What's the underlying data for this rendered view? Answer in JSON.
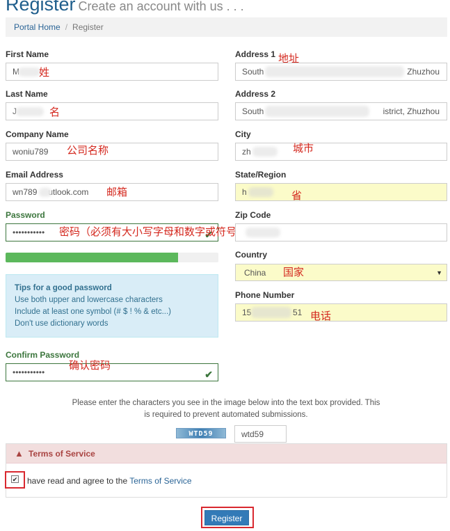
{
  "header": {
    "title": "Register",
    "subtitle": "Create an account with us . . ."
  },
  "breadcrumb": {
    "home": "Portal Home",
    "separator": "/",
    "current": "Register"
  },
  "form": {
    "first_name": {
      "label": "First Name",
      "value": "M",
      "annotation": "姓"
    },
    "last_name": {
      "label": "Last Name",
      "value": "J",
      "annotation": "名"
    },
    "company": {
      "label": "Company Name",
      "value": "woniu789",
      "annotation": "公司名称"
    },
    "email": {
      "label": "Email Address",
      "value_a": "wn789",
      "value_b": "utlook.com",
      "annotation": "邮箱"
    },
    "password": {
      "label": "Password",
      "value": "•••••••••••",
      "annotation": "密码（必须有大小写字母和数字或符号）",
      "strength": 0.81
    },
    "tips": {
      "title": "Tips for a good password",
      "line1": "Use both upper and lowercase characters",
      "line2": "Include at least one symbol (# $ ! % & etc...)",
      "line3": "Don't use dictionary words"
    },
    "confirm_password": {
      "label": "Confirm Password",
      "value": "•••••••••••",
      "annotation": "确认密码"
    },
    "address1": {
      "label": "Address 1",
      "value_a": "South",
      "value_b": "Zhuzhou",
      "annotation": "地址"
    },
    "address2": {
      "label": "Address 2",
      "value_a": "South",
      "value_b": "istrict, Zhuzhou"
    },
    "city": {
      "label": "City",
      "value": "zh",
      "annotation": "城市"
    },
    "state": {
      "label": "State/Region",
      "value": "h",
      "annotation": "省"
    },
    "zip": {
      "label": "Zip Code",
      "value": ""
    },
    "country": {
      "label": "Country",
      "value": "China",
      "annotation": "国家"
    },
    "phone": {
      "label": "Phone Number",
      "value_a": "15",
      "value_b": "51",
      "annotation": "电话"
    }
  },
  "captcha": {
    "instructions": "Please enter the characters you see in the image below into the text box provided. This is required to prevent automated submissions.",
    "image_text": "WTD59",
    "value": "wtd59"
  },
  "tos": {
    "header": "Terms of Service",
    "checkbox_checked": true,
    "agree_text": "have read and agree to the",
    "link": "Terms of Service"
  },
  "submit": {
    "label": "Register"
  },
  "colors": {
    "accent": "#337ab7",
    "success": "#5cb85c",
    "annotation": "#d4281e",
    "highlight": "#fbfbc9"
  }
}
